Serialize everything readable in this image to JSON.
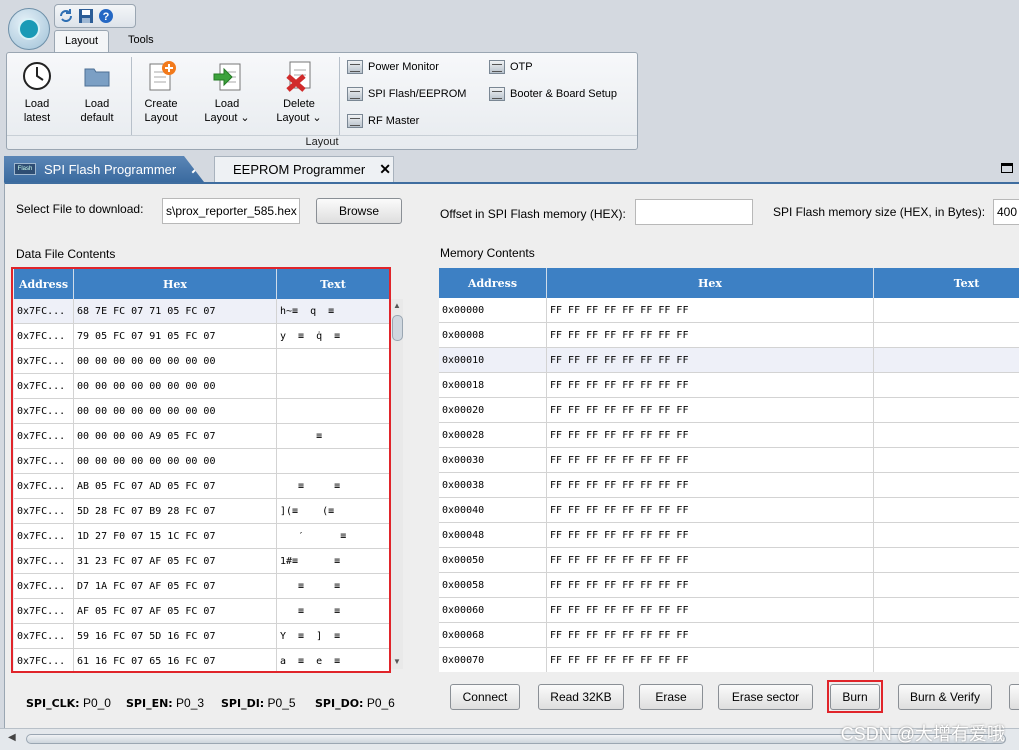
{
  "ribbon": {
    "tabs": [
      "Layout",
      "Tools"
    ],
    "buttons": [
      {
        "label1": "Load",
        "label2": "latest",
        "icon": "clock-icon"
      },
      {
        "label1": "Load",
        "label2": "default",
        "icon": "folder-icon"
      },
      {
        "label1": "Create",
        "label2": "Layout",
        "icon": "new-layout-icon"
      },
      {
        "label1": "Load",
        "label2": "Layout ⌄",
        "icon": "load-layout-icon"
      },
      {
        "label1": "Delete",
        "label2": "Layout ⌄",
        "icon": "delete-layout-icon"
      }
    ],
    "small_items": [
      "Power Monitor",
      "SPI Flash/EEPROM",
      "RF Master",
      "OTP",
      "Booter & Board Setup"
    ],
    "group_label": "Layout"
  },
  "doc_tabs": {
    "active": "SPI Flash Programmer",
    "inactive": "EEPROM Programmer",
    "flash_badge": "Flash"
  },
  "file": {
    "select_label": "Select File to download:",
    "file_value": "s\\prox_reporter_585.hex",
    "browse": "Browse",
    "offset_label": "Offset in SPI Flash memory (HEX):",
    "offset_value": "",
    "size_label": "SPI Flash memory size (HEX, in Bytes):",
    "size_value": "400"
  },
  "data_file": {
    "title": "Data File Contents",
    "headers": [
      "Address",
      "Hex",
      "Text"
    ],
    "rows": [
      [
        "0x7FC...",
        "68 7E FC 07 71 05 FC 07",
        "h~≡  q  ≡"
      ],
      [
        "0x7FC...",
        "79 05 FC 07 91 05 FC 07",
        "y  ≡  q̇  ≡"
      ],
      [
        "0x7FC...",
        "00 00 00 00 00 00 00 00",
        ""
      ],
      [
        "0x7FC...",
        "00 00 00 00 00 00 00 00",
        ""
      ],
      [
        "0x7FC...",
        "00 00 00 00 00 00 00 00",
        ""
      ],
      [
        "0x7FC...",
        "00 00 00 00 A9 05 FC 07",
        "      ≡"
      ],
      [
        "0x7FC...",
        "00 00 00 00 00 00 00 00",
        ""
      ],
      [
        "0x7FC...",
        "AB 05 FC 07 AD 05 FC 07",
        "   ≡     ≡"
      ],
      [
        "0x7FC...",
        "5D 28 FC 07 B9 28 FC 07",
        "](≡    (≡"
      ],
      [
        "0x7FC...",
        "1D 27 F0 07 15 1C FC 07",
        "   ′      ≡"
      ],
      [
        "0x7FC...",
        "31 23 FC 07 AF 05 FC 07",
        "1#≡      ≡"
      ],
      [
        "0x7FC...",
        "D7 1A FC 07 AF 05 FC 07",
        "   ≡     ≡"
      ],
      [
        "0x7FC...",
        "AF 05 FC 07 AF 05 FC 07",
        "   ≡     ≡"
      ],
      [
        "0x7FC...",
        "59 16 FC 07 5D 16 FC 07",
        "Y  ≡  ]  ≡"
      ],
      [
        "0x7FC...",
        "61 16 FC 07 65 16 FC 07",
        "a  ≡  e  ≡"
      ]
    ]
  },
  "memory": {
    "title": "Memory Contents",
    "headers": [
      "Address",
      "Hex",
      "Text"
    ],
    "rows": [
      [
        "0x00000",
        "FF FF FF FF FF FF FF FF",
        ""
      ],
      [
        "0x00008",
        "FF FF FF FF FF FF FF FF",
        ""
      ],
      [
        "0x00010",
        "FF FF FF FF FF FF FF FF",
        ""
      ],
      [
        "0x00018",
        "FF FF FF FF FF FF FF FF",
        ""
      ],
      [
        "0x00020",
        "FF FF FF FF FF FF FF FF",
        ""
      ],
      [
        "0x00028",
        "FF FF FF FF FF FF FF FF",
        ""
      ],
      [
        "0x00030",
        "FF FF FF FF FF FF FF FF",
        ""
      ],
      [
        "0x00038",
        "FF FF FF FF FF FF FF FF",
        ""
      ],
      [
        "0x00040",
        "FF FF FF FF FF FF FF FF",
        ""
      ],
      [
        "0x00048",
        "FF FF FF FF FF FF FF FF",
        ""
      ],
      [
        "0x00050",
        "FF FF FF FF FF FF FF FF",
        ""
      ],
      [
        "0x00058",
        "FF FF FF FF FF FF FF FF",
        ""
      ],
      [
        "0x00060",
        "FF FF FF FF FF FF FF FF",
        ""
      ],
      [
        "0x00068",
        "FF FF FF FF FF FF FF FF",
        ""
      ],
      [
        "0x00070",
        "FF FF FF FF FF FF FF FF",
        ""
      ]
    ]
  },
  "pins": [
    {
      "name": "SPI_CLK:",
      "value": "P0_0"
    },
    {
      "name": "SPI_EN:",
      "value": "P0_3"
    },
    {
      "name": "SPI_DI:",
      "value": "P0_5"
    },
    {
      "name": "SPI_DO:",
      "value": "P0_6"
    }
  ],
  "actions": [
    "Connect",
    "Read 32KB",
    "Erase",
    "Erase sector",
    "Burn",
    "Burn & Verify"
  ],
  "watermark": "CSDN @大增有爱哦",
  "colors": {
    "header_blue": "#3d80c4",
    "highlight_red": "#e0242a",
    "tab_active": "#3a6a9f"
  }
}
